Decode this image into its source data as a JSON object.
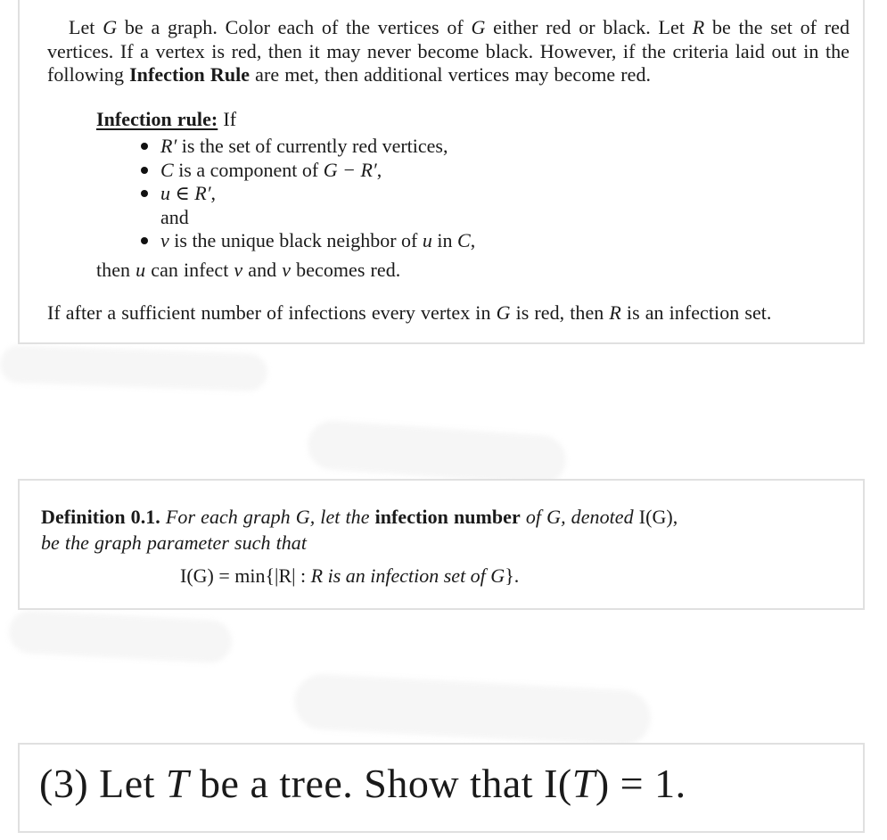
{
  "intro": {
    "p1": "Let ",
    "G1": "G",
    "p2": " be a graph.  Color each of the vertices of ",
    "G2": "G",
    "p3": " either red or black.  Let ",
    "R1": "R",
    "p4": " be the set of red vertices. If a vertex is red, then it may never become black. However, if the criteria laid out in the following ",
    "bold": "Infection Rule",
    "p5": " are met, then additional vertices may become red."
  },
  "rule": {
    "title": "Infection rule:",
    "after_title": " If",
    "bullets": [
      {
        "math": "R′",
        "text": " is the set of currently red vertices,"
      },
      {
        "math": "C",
        "text": " is a component of ",
        "math2": "G − R′",
        "tail": ","
      },
      {
        "math": "u ∈ R′",
        "text": ","
      },
      {
        "math": "v",
        "text": " is the unique black neighbor of ",
        "math2": "u",
        "text2": " in ",
        "math3": "C",
        "tail": ","
      }
    ],
    "and_label": "and",
    "then": {
      "t1": "then ",
      "u": "u",
      "t2": " can infect ",
      "v1": "v",
      "t3": " and ",
      "v2": "v",
      "t4": " becomes red."
    }
  },
  "closing": {
    "t1": "If after a sufficient number of infections every vertex in ",
    "G": "G",
    "t2": " is red, then ",
    "R": "R",
    "t3": " is an infection set."
  },
  "definition": {
    "label": "Definition 0.1.",
    "t1": " For each graph G, let the ",
    "bold": "infection number",
    "t2": " of G, denoted ",
    "notation": "I(G),",
    "t3": "be the graph parameter such that",
    "formula_left": "I(G) = min{|R| : ",
    "formula_it": "R is an infection set of G",
    "formula_right": "}."
  },
  "problem": {
    "num": "(3)",
    "t1": " Let ",
    "T1": "T",
    "t2": " be a tree.  Show that I(",
    "T2": "T",
    "t3": ") = 1."
  }
}
